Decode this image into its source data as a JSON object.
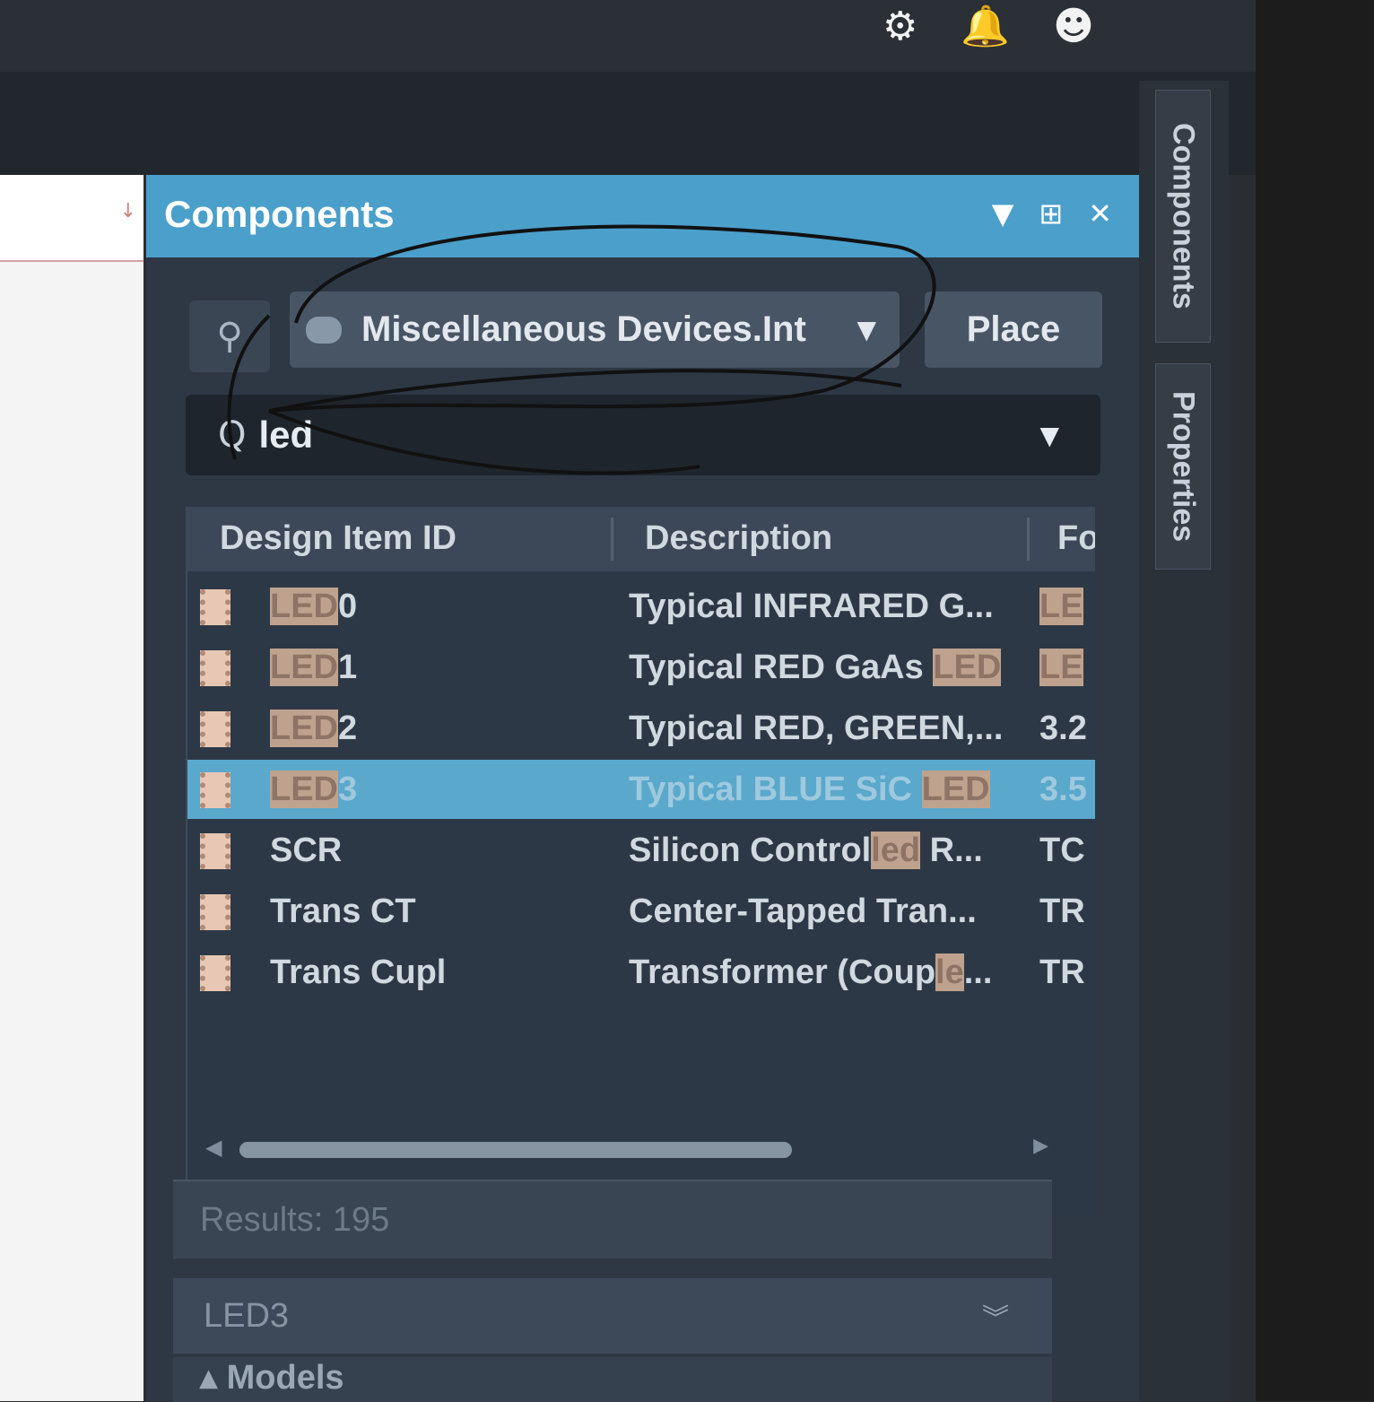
{
  "top_icons": [
    "gear-icon",
    "bell-icon",
    "user-icon"
  ],
  "top_glyphs": {
    "gear": "⚙",
    "bell": "🔔",
    "user": "☻"
  },
  "panel": {
    "title": "Components",
    "header_buttons": {
      "menu": "▼",
      "pin": "⊞",
      "close": "✕"
    }
  },
  "library": {
    "selected": "Miscellaneous Devices.IntLib",
    "display": "Miscellaneous Devices.Int",
    "caret": "▼"
  },
  "place_button": "Place",
  "search": {
    "icon": "Q",
    "value": "led",
    "caret": "▼"
  },
  "grid": {
    "columns": [
      "Design Item ID",
      "Description",
      "Fo"
    ],
    "rows": [
      {
        "id_hl": "LED",
        "id_rest": "0",
        "desc_pre": "Typical INFRARED G...",
        "desc_hl": "",
        "desc_post": "",
        "fp": "LE",
        "fp_hl": true
      },
      {
        "id_hl": "LED",
        "id_rest": "1",
        "desc_pre": "Typical RED GaAs ",
        "desc_hl": "LED",
        "desc_post": "",
        "fp": "LE",
        "fp_hl": true
      },
      {
        "id_hl": "LED",
        "id_rest": "2",
        "desc_pre": "Typical RED, GREEN,...",
        "desc_hl": "",
        "desc_post": "",
        "fp": "3.2",
        "fp_hl": false
      },
      {
        "id_hl": "LED",
        "id_rest": "3",
        "desc_pre": "Typical BLUE SiC ",
        "desc_hl": "LED",
        "desc_post": "",
        "fp": "3.5",
        "fp_hl": false,
        "selected": true
      },
      {
        "id_hl": "",
        "id_rest": "SCR",
        "desc_pre": "Silicon Control",
        "desc_hl": "led",
        "desc_post": " R...",
        "fp": "TC",
        "fp_hl": false
      },
      {
        "id_hl": "",
        "id_rest": "Trans CT",
        "desc_pre": "Center-Tapped Tran...",
        "desc_hl": "",
        "desc_post": "",
        "fp": "TR",
        "fp_hl": false
      },
      {
        "id_hl": "",
        "id_rest": "Trans Cupl",
        "desc_pre": "Transformer (Coup",
        "desc_hl": "le",
        "desc_post": "...",
        "fp": "TR",
        "fp_hl": false
      }
    ]
  },
  "results_text": "Results: 195",
  "detail": {
    "name": "LED3",
    "chevron": "︾"
  },
  "models_label": "▴ Models",
  "side_tabs": [
    "Components",
    "Properties"
  ]
}
